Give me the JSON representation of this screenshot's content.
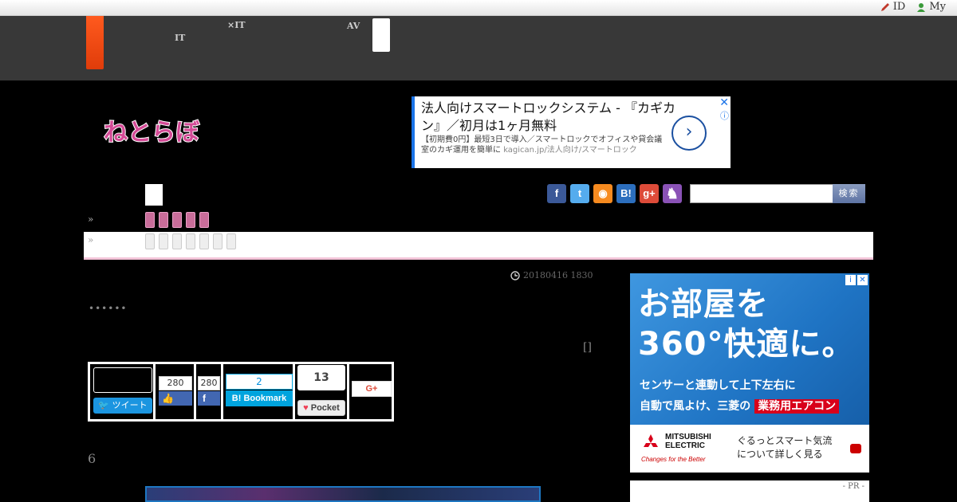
{
  "topbar": {
    "id_label": "ID",
    "my_label": "My"
  },
  "nav": {
    "items": [
      {
        "line1": "",
        "line2": "IT"
      },
      {
        "line1": "",
        "line2": "×IT"
      },
      {
        "line1": "AV",
        "line2": ""
      }
    ]
  },
  "logo": {
    "text": "ねとらぼ"
  },
  "top_ad": {
    "title": "法人向けスマートロックシステム - 『カギカン』／初月は1ヶ月無料",
    "body": "【初期費0円】最短3日で導入／スマートロックでオフィスや貸会議室のカギ運用を簡単に",
    "url": "kagican.jp/法人向け/スマートロック",
    "close": "✕",
    "info": "ⓘ",
    "arrow": "›"
  },
  "search": {
    "button_label": "検索",
    "placeholder": ""
  },
  "social_icons": [
    {
      "name": "facebook-icon",
      "glyph": "f",
      "color": "#3b5998"
    },
    {
      "name": "twitter-icon",
      "glyph": "t",
      "color": "#55acee"
    },
    {
      "name": "rss-icon",
      "glyph": "◉",
      "color": "#f68a1f"
    },
    {
      "name": "hatena-icon",
      "glyph": "B!",
      "color": "#2c6ebd"
    },
    {
      "name": "googleplus-icon",
      "glyph": "g+",
      "color": "#dd4b39"
    },
    {
      "name": "cat-icon",
      "glyph": "♞",
      "color": "#8a52b6"
    }
  ],
  "breadcrumb": {
    "sep": "»"
  },
  "article": {
    "date": "20180416 1830",
    "dots": "••••••",
    "brackets": "[]",
    "six": "6"
  },
  "share": {
    "tweet_label": "ツイート",
    "like_count": "280",
    "fb_count": "280",
    "bookmark_count": "2",
    "bookmark_label": "Bookmark",
    "pocket_count": "13",
    "pocket_label": "Pocket",
    "gplus_label": "G+"
  },
  "right_ad": {
    "headline": "お部屋を\n360°快適に。",
    "sub1": "センサーと連動して上下左右に",
    "sub2_plain": "自動で風よけ、三菱の",
    "sub2_red": "業務用エアコン",
    "brand_line1": "MITSUBISHI",
    "brand_line2": "ELECTRIC",
    "brand_tag": "Changes for the Better",
    "copy1": "ぐるっとスマート気流",
    "copy2": "について詳しく見る"
  },
  "pr": {
    "label": "- PR -"
  }
}
